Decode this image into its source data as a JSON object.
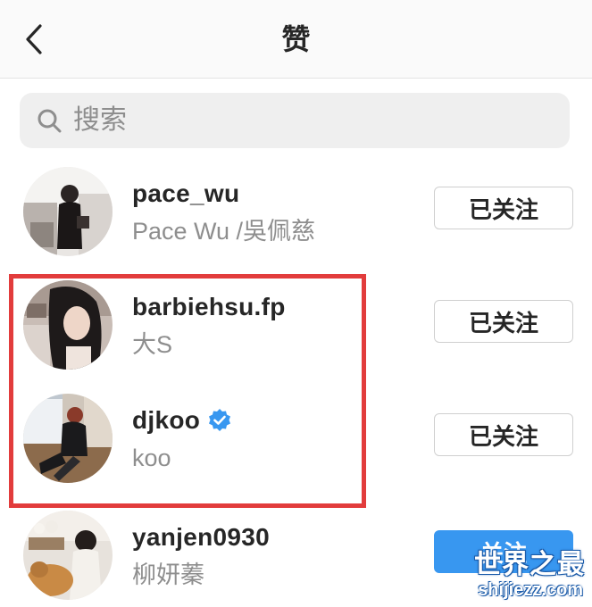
{
  "header": {
    "title": "赞",
    "back_icon": "chevron-left-icon"
  },
  "search": {
    "placeholder": "搜索",
    "icon": "search-icon"
  },
  "users": [
    {
      "username": "pace_wu",
      "full_name": "Pace Wu /吳佩慈",
      "verified": false,
      "button_label": "已关注",
      "button_style": "following"
    },
    {
      "username": "barbiehsu.fp",
      "full_name": "大S",
      "verified": false,
      "button_label": "已关注",
      "button_style": "following"
    },
    {
      "username": "djkoo",
      "full_name": "koo",
      "verified": true,
      "button_label": "已关注",
      "button_style": "following"
    },
    {
      "username": "yanjen0930",
      "full_name": "柳妍蓁",
      "verified": false,
      "button_label": "关注",
      "button_style": "follow"
    }
  ],
  "watermark": {
    "title": "世界之最",
    "url": "shijiezz.com"
  },
  "colors": {
    "follow_blue": "#3897f0",
    "highlight_red": "#e23c3c",
    "verified_blue": "#3897f0",
    "text_primary": "#262626",
    "text_secondary": "#8e8e8e"
  }
}
